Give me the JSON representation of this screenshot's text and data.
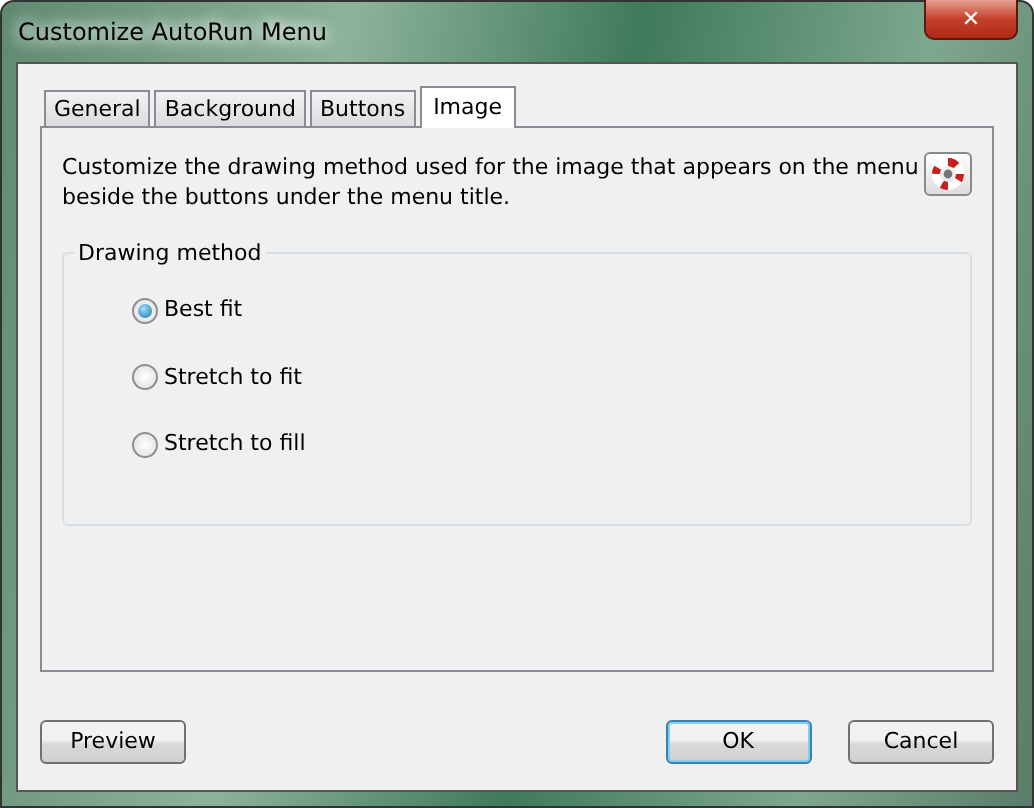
{
  "window": {
    "title": "Customize AutoRun Menu",
    "close": "✕"
  },
  "tabs": [
    {
      "label": "General",
      "selected": false
    },
    {
      "label": "Background",
      "selected": false
    },
    {
      "label": "Buttons",
      "selected": false
    },
    {
      "label": "Image",
      "selected": true
    }
  ],
  "description": "Customize the drawing method used for the image that appears on the menu beside the buttons under the menu title.",
  "group": {
    "title": "Drawing method",
    "options": [
      {
        "label": "Best fit",
        "selected": true
      },
      {
        "label": "Stretch to fit",
        "selected": false
      },
      {
        "label": "Stretch to fill",
        "selected": false
      }
    ]
  },
  "buttons": [
    {
      "label": "Preview",
      "default": false
    },
    {
      "label": "OK",
      "default": true
    },
    {
      "label": "Cancel",
      "default": false
    }
  ]
}
